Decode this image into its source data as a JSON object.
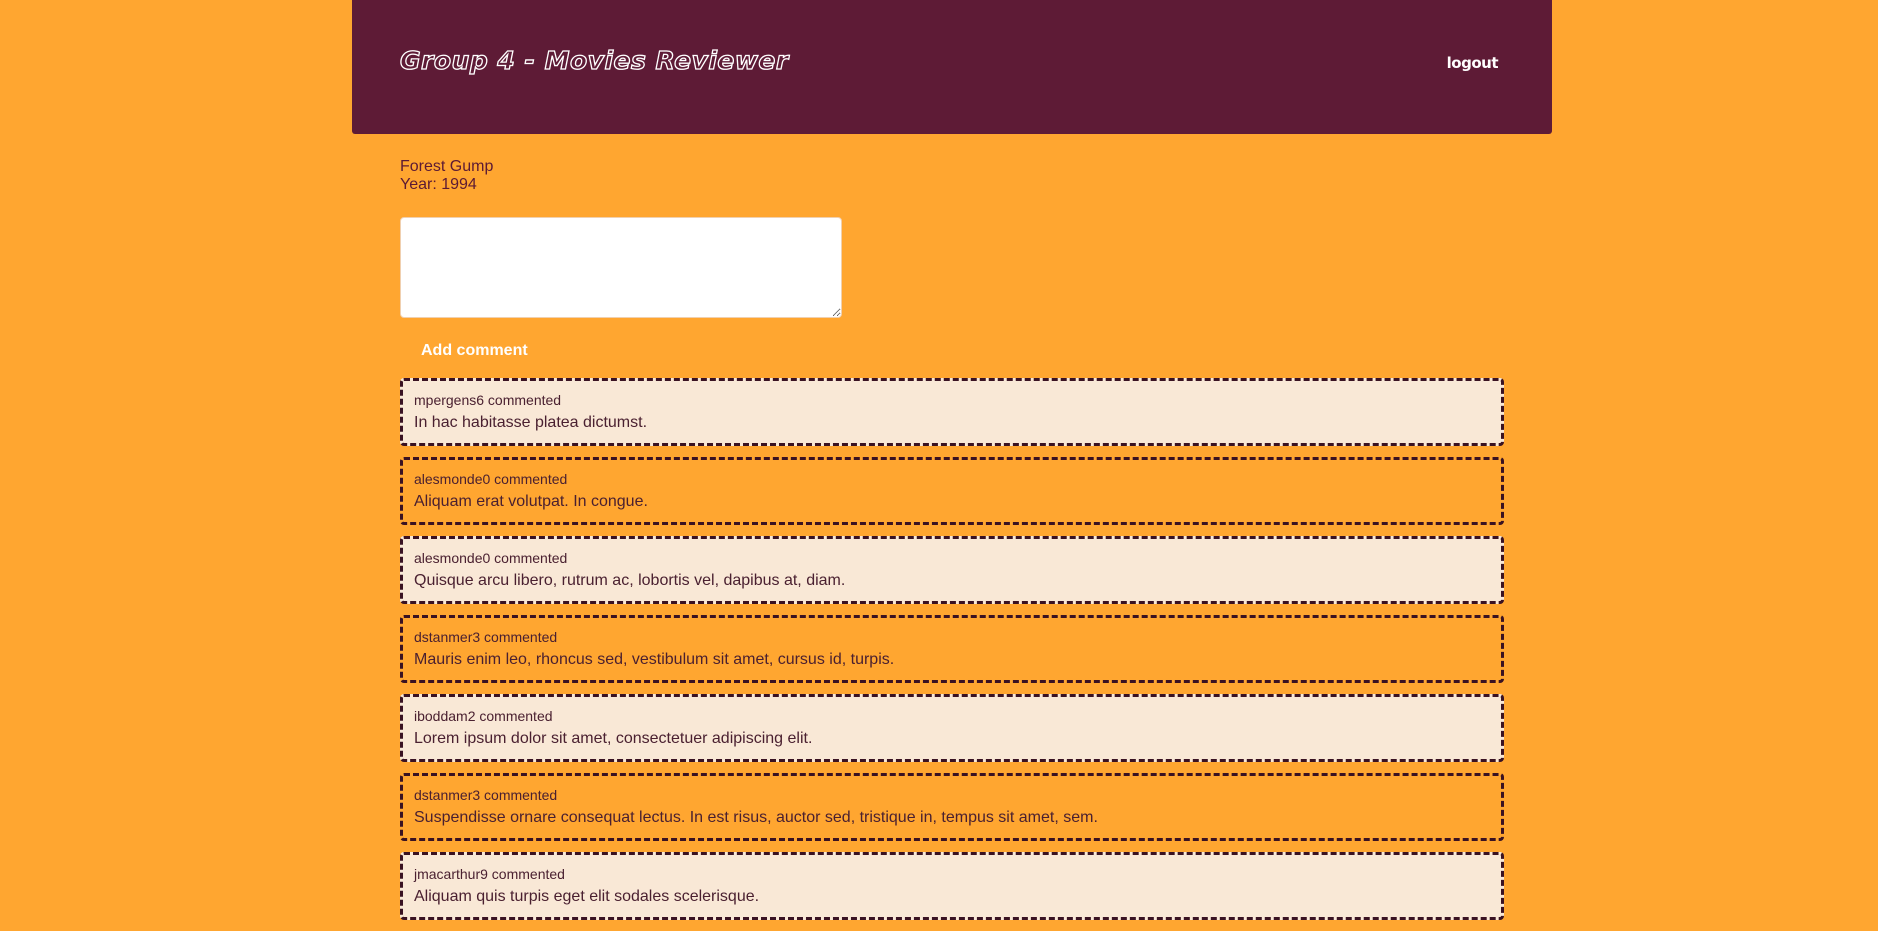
{
  "header": {
    "brand": "Group 4 - Movies Reviewer",
    "logout_label": "logout"
  },
  "movie": {
    "title": "Forest Gump",
    "year_text": "Year: 1994"
  },
  "comment_form": {
    "textarea_value": "",
    "add_label": "Add comment"
  },
  "comments": [
    {
      "author_line": "mpergens6 commented",
      "text": "In hac habitasse platea dictumst."
    },
    {
      "author_line": "alesmonde0 commented",
      "text": "Aliquam erat volutpat. In congue."
    },
    {
      "author_line": "alesmonde0 commented",
      "text": "Quisque arcu libero, rutrum ac, lobortis vel, dapibus at, diam."
    },
    {
      "author_line": "dstanmer3 commented",
      "text": "Mauris enim leo, rhoncus sed, vestibulum sit amet, cursus id, turpis."
    },
    {
      "author_line": "iboddam2 commented",
      "text": "Lorem ipsum dolor sit amet, consectetuer adipiscing elit."
    },
    {
      "author_line": "dstanmer3 commented",
      "text": "Suspendisse ornare consequat lectus. In est risus, auctor sed, tristique in, tempus sit amet, sem."
    },
    {
      "author_line": "jmacarthur9 commented",
      "text": "Aliquam quis turpis eget elit sodales scelerisque."
    }
  ],
  "colors": {
    "background": "#ffa630",
    "header": "#5e1b36",
    "comment_light": "#f9e8d6",
    "comment_border": "#3a1222"
  }
}
